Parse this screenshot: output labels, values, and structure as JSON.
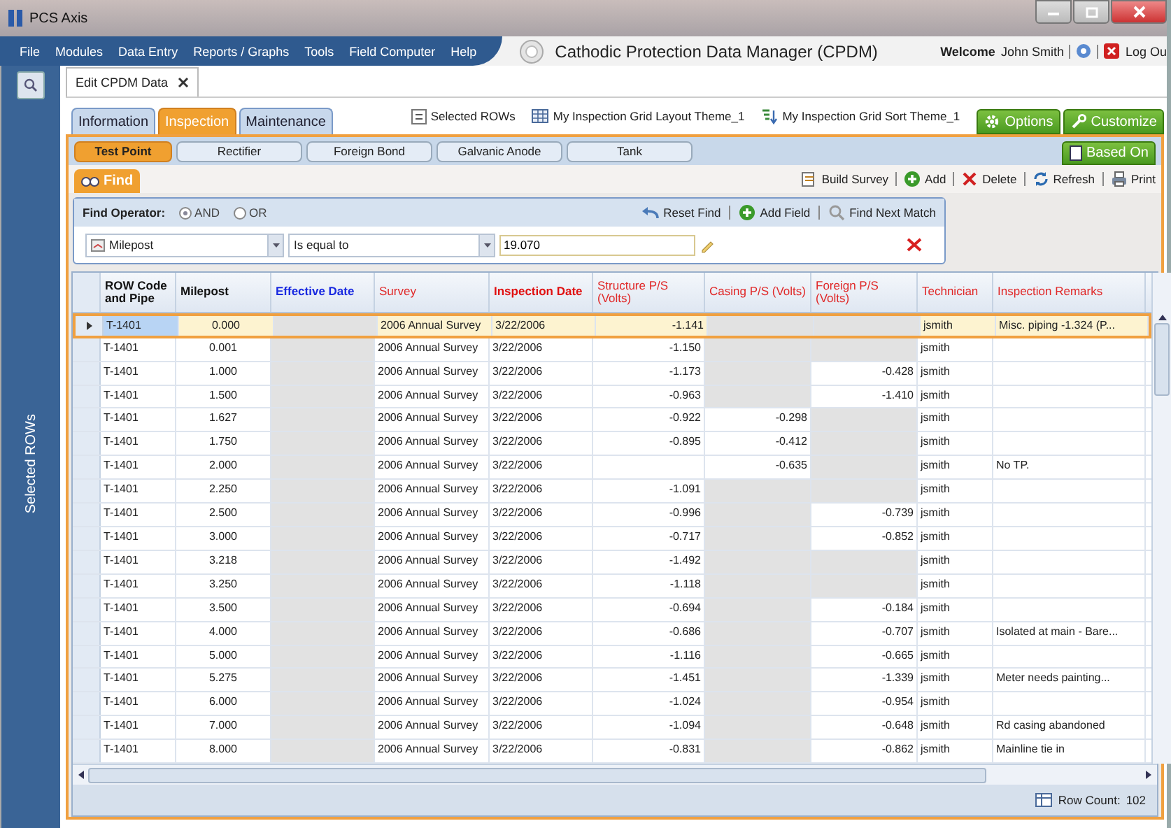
{
  "window": {
    "title": "PCS Axis"
  },
  "menu": [
    "File",
    "Modules",
    "Data Entry",
    "Reports / Graphs",
    "Tools",
    "Field Computer",
    "Help"
  ],
  "app_title": "Cathodic Protection Data Manager (CPDM)",
  "user": {
    "welcome": "Welcome",
    "name": "John Smith",
    "logout": "Log Ou"
  },
  "sidebar": {
    "label": "Selected ROWs"
  },
  "document_tab": {
    "label": "Edit CPDM Data"
  },
  "tabs": [
    {
      "label": "Information",
      "selected": false
    },
    {
      "label": "Inspection",
      "selected": true
    },
    {
      "label": "Maintenance",
      "selected": false
    }
  ],
  "themes": [
    {
      "label": "Selected ROWs",
      "kind": "rows"
    },
    {
      "label": "My Inspection Grid Layout Theme_1",
      "kind": "layout"
    },
    {
      "label": "My Inspection Grid Sort Theme_1",
      "kind": "sort"
    }
  ],
  "top_buttons": [
    {
      "label": "Options",
      "kind": "gear"
    },
    {
      "label": "Customize",
      "kind": "wrench"
    }
  ],
  "subtabs": [
    {
      "label": "Test Point",
      "selected": true
    },
    {
      "label": "Rectifier",
      "selected": false
    },
    {
      "label": "Foreign Bond",
      "selected": false
    },
    {
      "label": "Galvanic Anode",
      "selected": false
    },
    {
      "label": "Tank",
      "selected": false
    }
  ],
  "based_on": "Based On",
  "find_tab": "Find",
  "toolbar": [
    {
      "label": "Build Survey",
      "kind": "survey"
    },
    {
      "label": "Add",
      "kind": "add"
    },
    {
      "label": "Delete",
      "kind": "delete"
    },
    {
      "label": "Refresh",
      "kind": "refresh"
    },
    {
      "label": "Print",
      "kind": "print"
    }
  ],
  "find": {
    "operator_label": "Find Operator:",
    "operators": [
      {
        "label": "AND",
        "selected": true
      },
      {
        "label": "OR",
        "selected": false
      }
    ],
    "actions": [
      {
        "label": "Reset Find",
        "kind": "reset"
      },
      {
        "label": "Add Field",
        "kind": "add"
      },
      {
        "label": "Find Next Match",
        "kind": "search"
      }
    ],
    "field": "Milepost",
    "condition": "Is equal to",
    "value": "19.070"
  },
  "grid": {
    "columns": [
      {
        "label": "ROW Code and Pipe",
        "kind": "key"
      },
      {
        "label": "Milepost",
        "kind": "key"
      },
      {
        "label": "Effective Date",
        "kind": "linked",
        "shade_empty": true
      },
      {
        "label": "Survey",
        "kind": "optional"
      },
      {
        "label": "Inspection Date",
        "kind": "required"
      },
      {
        "label": "Structure P/S (Volts)",
        "kind": "optional",
        "shade_empty": false
      },
      {
        "label": "Casing P/S (Volts)",
        "kind": "optional",
        "shade_empty": true
      },
      {
        "label": "Foreign P/S (Volts)",
        "kind": "optional",
        "shade_empty": true
      },
      {
        "label": "Technician",
        "kind": "optional"
      },
      {
        "label": "Inspection Remarks",
        "kind": "optional",
        "shade_empty": false
      }
    ],
    "rows": [
      {
        "selected": true,
        "cells": [
          "T-1401",
          "0.000",
          null,
          "2006 Annual Survey",
          "3/22/2006",
          "-1.141",
          null,
          null,
          "jsmith",
          "Misc. piping -1.324 (P..."
        ]
      },
      {
        "selected": false,
        "cells": [
          "T-1401",
          "0.001",
          null,
          "2006 Annual Survey",
          "3/22/2006",
          "-1.150",
          null,
          null,
          "jsmith",
          null
        ]
      },
      {
        "selected": false,
        "cells": [
          "T-1401",
          "1.000",
          null,
          "2006 Annual Survey",
          "3/22/2006",
          "-1.173",
          null,
          "-0.428",
          "jsmith",
          null
        ]
      },
      {
        "selected": false,
        "cells": [
          "T-1401",
          "1.500",
          null,
          "2006 Annual Survey",
          "3/22/2006",
          "-0.963",
          null,
          "-1.410",
          "jsmith",
          null
        ]
      },
      {
        "selected": false,
        "cells": [
          "T-1401",
          "1.627",
          null,
          "2006 Annual Survey",
          "3/22/2006",
          "-0.922",
          "-0.298",
          null,
          "jsmith",
          null
        ]
      },
      {
        "selected": false,
        "cells": [
          "T-1401",
          "1.750",
          null,
          "2006 Annual Survey",
          "3/22/2006",
          "-0.895",
          "-0.412",
          null,
          "jsmith",
          null
        ]
      },
      {
        "selected": false,
        "cells": [
          "T-1401",
          "2.000",
          null,
          "2006 Annual Survey",
          "3/22/2006",
          null,
          "-0.635",
          null,
          "jsmith",
          "No TP."
        ]
      },
      {
        "selected": false,
        "cells": [
          "T-1401",
          "2.250",
          null,
          "2006 Annual Survey",
          "3/22/2006",
          "-1.091",
          null,
          null,
          "jsmith",
          null
        ]
      },
      {
        "selected": false,
        "cells": [
          "T-1401",
          "2.500",
          null,
          "2006 Annual Survey",
          "3/22/2006",
          "-0.996",
          null,
          "-0.739",
          "jsmith",
          null
        ]
      },
      {
        "selected": false,
        "cells": [
          "T-1401",
          "3.000",
          null,
          "2006 Annual Survey",
          "3/22/2006",
          "-0.717",
          null,
          "-0.852",
          "jsmith",
          null
        ]
      },
      {
        "selected": false,
        "cells": [
          "T-1401",
          "3.218",
          null,
          "2006 Annual Survey",
          "3/22/2006",
          "-1.492",
          null,
          null,
          "jsmith",
          null
        ]
      },
      {
        "selected": false,
        "cells": [
          "T-1401",
          "3.250",
          null,
          "2006 Annual Survey",
          "3/22/2006",
          "-1.118",
          null,
          null,
          "jsmith",
          null
        ]
      },
      {
        "selected": false,
        "cells": [
          "T-1401",
          "3.500",
          null,
          "2006 Annual Survey",
          "3/22/2006",
          "-0.694",
          null,
          "-0.184",
          "jsmith",
          null
        ]
      },
      {
        "selected": false,
        "cells": [
          "T-1401",
          "4.000",
          null,
          "2006 Annual Survey",
          "3/22/2006",
          "-0.686",
          null,
          "-0.707",
          "jsmith",
          "Isolated at main - Bare..."
        ]
      },
      {
        "selected": false,
        "cells": [
          "T-1401",
          "5.000",
          null,
          "2006 Annual Survey",
          "3/22/2006",
          "-1.116",
          null,
          "-0.665",
          "jsmith",
          null
        ]
      },
      {
        "selected": false,
        "cells": [
          "T-1401",
          "5.275",
          null,
          "2006 Annual Survey",
          "3/22/2006",
          "-1.451",
          null,
          "-1.339",
          "jsmith",
          "Meter needs painting..."
        ]
      },
      {
        "selected": false,
        "cells": [
          "T-1401",
          "6.000",
          null,
          "2006 Annual Survey",
          "3/22/2006",
          "-1.024",
          null,
          "-0.954",
          "jsmith",
          null
        ]
      },
      {
        "selected": false,
        "cells": [
          "T-1401",
          "7.000",
          null,
          "2006 Annual Survey",
          "3/22/2006",
          "-1.094",
          null,
          "-0.648",
          "jsmith",
          "Rd casing abandoned"
        ]
      },
      {
        "selected": false,
        "cells": [
          "T-1401",
          "8.000",
          null,
          "2006 Annual Survey",
          "3/22/2006",
          "-0.831",
          null,
          "-0.862",
          "jsmith",
          "Mainline tie in"
        ]
      }
    ]
  },
  "row_count": {
    "label": "Row Count:",
    "value": "102"
  }
}
